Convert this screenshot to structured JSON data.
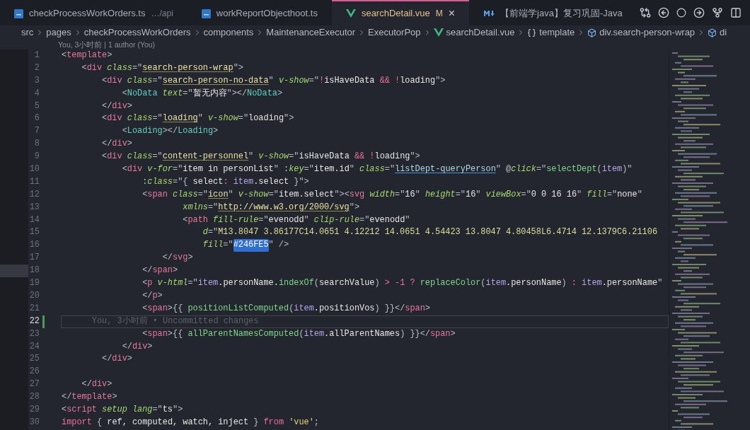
{
  "tabs": [
    {
      "label": "checkProcessWorkOrders.ts",
      "description": "…/api",
      "modified": false,
      "selected": false
    },
    {
      "label": "workReportObjecthoot.ts",
      "modified": false,
      "selected": false
    },
    {
      "label": "searchDetail.vue",
      "status": "M",
      "modified": true,
      "selected": true,
      "close": "×"
    },
    {
      "label": "【前端学java】复习巩固-Java",
      "modified": false,
      "selected": false
    }
  ],
  "breadcrumbs": [
    "src",
    "pages",
    "checkProcessWorkOrders",
    "components",
    "MaintenanceExecutor",
    "ExecutorPop",
    "searchDetail.vue",
    "template",
    "div.search-person-wrap",
    "di"
  ],
  "codelens": "You, 3小时前 | 1 author (You)",
  "lines": [
    {
      "number": "1",
      "current": false,
      "changed": false,
      "tokens": [
        {
          "kind": "p",
          "text": "<"
        },
        {
          "kind": "tag",
          "text": "template"
        },
        {
          "kind": "p",
          "text": ">"
        }
      ]
    },
    {
      "number": "2",
      "current": false,
      "changed": false,
      "tokens": [
        {
          "kind": "p",
          "text": "    <"
        },
        {
          "kind": "tag",
          "text": "div "
        },
        {
          "kind": "attr",
          "text": "class"
        },
        {
          "kind": "p",
          "text": "=\""
        },
        {
          "kind": "cls",
          "text": "search-person-wrap"
        },
        {
          "kind": "p",
          "text": "\">"
        }
      ]
    },
    {
      "number": "3",
      "current": false,
      "changed": false,
      "tokens": [
        {
          "kind": "p",
          "text": "        <"
        },
        {
          "kind": "tag",
          "text": "div "
        },
        {
          "kind": "attr",
          "text": "class"
        },
        {
          "kind": "p",
          "text": "=\""
        },
        {
          "kind": "cls",
          "text": "search-person-no-data"
        },
        {
          "kind": "p",
          "text": "\" "
        },
        {
          "kind": "attr",
          "text": "v-show"
        },
        {
          "kind": "p",
          "text": "=\""
        },
        {
          "kind": "op",
          "text": "!"
        },
        {
          "kind": "txt",
          "text": "isHaveData "
        },
        {
          "kind": "op",
          "text": "&& !"
        },
        {
          "kind": "txt",
          "text": "loading"
        },
        {
          "kind": "p",
          "text": "\">"
        }
      ]
    },
    {
      "number": "4",
      "current": false,
      "changed": false,
      "tokens": [
        {
          "kind": "p",
          "text": "            <"
        },
        {
          "kind": "comp",
          "text": "NoData "
        },
        {
          "kind": "attr",
          "text": "text"
        },
        {
          "kind": "p",
          "text": "=\""
        },
        {
          "kind": "txt",
          "text": "暂无内容"
        },
        {
          "kind": "p",
          "text": "\"></"
        },
        {
          "kind": "comp",
          "text": "NoData"
        },
        {
          "kind": "p",
          "text": ">"
        }
      ]
    },
    {
      "number": "5",
      "current": false,
      "changed": false,
      "tokens": [
        {
          "kind": "p",
          "text": "        </"
        },
        {
          "kind": "tag",
          "text": "div"
        },
        {
          "kind": "p",
          "text": ">"
        }
      ]
    },
    {
      "number": "6",
      "current": false,
      "changed": false,
      "tokens": [
        {
          "kind": "p",
          "text": "        <"
        },
        {
          "kind": "tag",
          "text": "div "
        },
        {
          "kind": "attr",
          "text": "class"
        },
        {
          "kind": "p",
          "text": "=\""
        },
        {
          "kind": "cls",
          "text": "loading"
        },
        {
          "kind": "p",
          "text": "\" "
        },
        {
          "kind": "attr",
          "text": "v-show"
        },
        {
          "kind": "p",
          "text": "=\""
        },
        {
          "kind": "txt",
          "text": "loading"
        },
        {
          "kind": "p",
          "text": "\">"
        }
      ]
    },
    {
      "number": "7",
      "current": false,
      "changed": false,
      "tokens": [
        {
          "kind": "p",
          "text": "            <"
        },
        {
          "kind": "comp",
          "text": "Loading"
        },
        {
          "kind": "p",
          "text": "></"
        },
        {
          "kind": "comp",
          "text": "Loading"
        },
        {
          "kind": "p",
          "text": ">"
        }
      ]
    },
    {
      "number": "8",
      "current": false,
      "changed": false,
      "tokens": [
        {
          "kind": "p",
          "text": "        </"
        },
        {
          "kind": "tag",
          "text": "div"
        },
        {
          "kind": "p",
          "text": ">"
        }
      ]
    },
    {
      "number": "9",
      "current": false,
      "changed": false,
      "tokens": [
        {
          "kind": "p",
          "text": "        <"
        },
        {
          "kind": "tag",
          "text": "div "
        },
        {
          "kind": "attr",
          "text": "class"
        },
        {
          "kind": "p",
          "text": "=\""
        },
        {
          "kind": "cls",
          "text": "content-personnel"
        },
        {
          "kind": "p",
          "text": "\" "
        },
        {
          "kind": "attr",
          "text": "v-show"
        },
        {
          "kind": "p",
          "text": "=\""
        },
        {
          "kind": "txt",
          "text": "isHaveData "
        },
        {
          "kind": "op",
          "text": "&& !"
        },
        {
          "kind": "txt",
          "text": "loading"
        },
        {
          "kind": "p",
          "text": "\">"
        }
      ]
    },
    {
      "number": "10",
      "current": false,
      "changed": false,
      "tokens": [
        {
          "kind": "p",
          "text": "            <"
        },
        {
          "kind": "tag",
          "text": "div "
        },
        {
          "kind": "attr",
          "text": "v-for"
        },
        {
          "kind": "p",
          "text": "=\""
        },
        {
          "kind": "txt",
          "text": "item in personList"
        },
        {
          "kind": "p",
          "text": "\" :"
        },
        {
          "kind": "attr",
          "text": "key"
        },
        {
          "kind": "p",
          "text": "=\""
        },
        {
          "kind": "txt",
          "text": "item.id"
        },
        {
          "kind": "p",
          "text": "\" "
        },
        {
          "kind": "attr",
          "text": "class"
        },
        {
          "kind": "p",
          "text": "=\""
        },
        {
          "kind": "link",
          "text": "listDept-queryPerson"
        },
        {
          "kind": "p",
          "text": "\" @"
        },
        {
          "kind": "attr",
          "text": "click"
        },
        {
          "kind": "p",
          "text": "=\""
        },
        {
          "kind": "fn",
          "text": "selectDept"
        },
        {
          "kind": "p",
          "text": "("
        },
        {
          "kind": "var",
          "text": "item"
        },
        {
          "kind": "p",
          "text": ")\""
        }
      ]
    },
    {
      "number": "11",
      "current": false,
      "changed": false,
      "tokens": [
        {
          "kind": "p",
          "text": "                :"
        },
        {
          "kind": "attr",
          "text": "class"
        },
        {
          "kind": "p",
          "text": "=\"{ "
        },
        {
          "kind": "txt",
          "text": "select"
        },
        {
          "kind": "op",
          "text": ": "
        },
        {
          "kind": "var",
          "text": "item"
        },
        {
          "kind": "txt",
          "text": ".select"
        },
        {
          "kind": "p",
          "text": " }\">"
        }
      ]
    },
    {
      "number": "12",
      "current": false,
      "changed": false,
      "tokens": [
        {
          "kind": "p",
          "text": "                <"
        },
        {
          "kind": "tag",
          "text": "span "
        },
        {
          "kind": "attr",
          "text": "class"
        },
        {
          "kind": "p",
          "text": "=\""
        },
        {
          "kind": "cls",
          "text": "icon"
        },
        {
          "kind": "p",
          "text": "\" "
        },
        {
          "kind": "attr",
          "text": "v-show"
        },
        {
          "kind": "p",
          "text": "=\""
        },
        {
          "kind": "txt",
          "text": "item.select"
        },
        {
          "kind": "p",
          "text": "\"><"
        },
        {
          "kind": "tag",
          "text": "svg "
        },
        {
          "kind": "attr",
          "text": "width"
        },
        {
          "kind": "p",
          "text": "=\""
        },
        {
          "kind": "txt",
          "text": "16"
        },
        {
          "kind": "p",
          "text": "\" "
        },
        {
          "kind": "attr",
          "text": "height"
        },
        {
          "kind": "p",
          "text": "=\""
        },
        {
          "kind": "txt",
          "text": "16"
        },
        {
          "kind": "p",
          "text": "\" "
        },
        {
          "kind": "attr",
          "text": "viewBox"
        },
        {
          "kind": "p",
          "text": "=\""
        },
        {
          "kind": "txt",
          "text": "0 0 16 16"
        },
        {
          "kind": "p",
          "text": "\" "
        },
        {
          "kind": "attr",
          "text": "fill"
        },
        {
          "kind": "p",
          "text": "=\""
        },
        {
          "kind": "txt",
          "text": "none"
        },
        {
          "kind": "p",
          "text": "\""
        }
      ]
    },
    {
      "number": "13",
      "current": false,
      "changed": false,
      "tokens": [
        {
          "kind": "attr",
          "text": "                        xmlns"
        },
        {
          "kind": "p",
          "text": "=\""
        },
        {
          "kind": "cls",
          "text": "http://www.w3.org/2000/svg"
        },
        {
          "kind": "p",
          "text": "\">"
        }
      ]
    },
    {
      "number": "14",
      "current": false,
      "changed": false,
      "tokens": [
        {
          "kind": "p",
          "text": "                        <"
        },
        {
          "kind": "tag",
          "text": "path "
        },
        {
          "kind": "attr",
          "text": "fill-rule"
        },
        {
          "kind": "p",
          "text": "=\""
        },
        {
          "kind": "txt",
          "text": "evenodd"
        },
        {
          "kind": "p",
          "text": "\" "
        },
        {
          "kind": "attr",
          "text": "clip-rule"
        },
        {
          "kind": "p",
          "text": "=\""
        },
        {
          "kind": "txt",
          "text": "evenodd"
        },
        {
          "kind": "p",
          "text": "\""
        }
      ]
    },
    {
      "number": "15",
      "current": false,
      "changed": false,
      "tokens": [
        {
          "kind": "attr",
          "text": "                            d"
        },
        {
          "kind": "p",
          "text": "=\""
        },
        {
          "kind": "num",
          "text": "M13.8047 3.86177C14.0651 4.12212 14.0651 4.54423 13.8047 4.80458L6.4714 12.1379C6.21106"
        }
      ]
    },
    {
      "number": "16",
      "current": false,
      "changed": false,
      "tokens": [
        {
          "kind": "attr",
          "text": "                            fill"
        },
        {
          "kind": "p",
          "text": "=\""
        },
        {
          "kind": "sel",
          "text": "#246FE5"
        },
        {
          "kind": "p",
          "text": "\" />"
        }
      ]
    },
    {
      "number": "17",
      "current": false,
      "changed": false,
      "tokens": [
        {
          "kind": "p",
          "text": "                    </"
        },
        {
          "kind": "tag",
          "text": "svg"
        },
        {
          "kind": "p",
          "text": ">"
        }
      ]
    },
    {
      "number": "18",
      "current": false,
      "changed": false,
      "tokens": [
        {
          "kind": "p",
          "text": "                </"
        },
        {
          "kind": "tag",
          "text": "span"
        },
        {
          "kind": "p",
          "text": ">"
        }
      ]
    },
    {
      "number": "19",
      "current": false,
      "changed": false,
      "tokens": [
        {
          "kind": "p",
          "text": "                <"
        },
        {
          "kind": "tag",
          "text": "p "
        },
        {
          "kind": "attr",
          "text": "v-html"
        },
        {
          "kind": "p",
          "text": "=\""
        },
        {
          "kind": "var",
          "text": "item"
        },
        {
          "kind": "txt",
          "text": ".personName."
        },
        {
          "kind": "fn",
          "text": "indexOf"
        },
        {
          "kind": "p",
          "text": "("
        },
        {
          "kind": "txt",
          "text": "searchValue"
        },
        {
          "kind": "p",
          "text": ")"
        },
        {
          "kind": "op",
          "text": " > -1 ? "
        },
        {
          "kind": "fn",
          "text": "replaceColor"
        },
        {
          "kind": "p",
          "text": "("
        },
        {
          "kind": "var",
          "text": "item"
        },
        {
          "kind": "txt",
          "text": ".personName"
        },
        {
          "kind": "p",
          "text": ")"
        },
        {
          "kind": "op",
          "text": " : "
        },
        {
          "kind": "var",
          "text": "item"
        },
        {
          "kind": "txt",
          "text": ".personName"
        },
        {
          "kind": "p",
          "text": "\""
        }
      ]
    },
    {
      "number": "20",
      "current": false,
      "changed": false,
      "tokens": [
        {
          "kind": "p",
          "text": "                </"
        },
        {
          "kind": "tag",
          "text": "p"
        },
        {
          "kind": "p",
          "text": ">"
        }
      ]
    },
    {
      "number": "21",
      "current": false,
      "changed": false,
      "tokens": [
        {
          "kind": "p",
          "text": "                <"
        },
        {
          "kind": "tag",
          "text": "span"
        },
        {
          "kind": "p",
          "text": ">{{ "
        },
        {
          "kind": "fn",
          "text": "positionListComputed"
        },
        {
          "kind": "p",
          "text": "("
        },
        {
          "kind": "var",
          "text": "item"
        },
        {
          "kind": "txt",
          "text": ".positionVos"
        },
        {
          "kind": "p",
          "text": ") }}</"
        },
        {
          "kind": "tag",
          "text": "span"
        },
        {
          "kind": "p",
          "text": ">"
        }
      ]
    },
    {
      "number": "22",
      "current": true,
      "changed": true,
      "tokens": [
        {
          "kind": "ghost",
          "text": "      You, 3小时前 • Uncommitted changes"
        }
      ]
    },
    {
      "number": "23",
      "current": false,
      "changed": false,
      "tokens": [
        {
          "kind": "p",
          "text": "                <"
        },
        {
          "kind": "tag",
          "text": "span"
        },
        {
          "kind": "p",
          "text": ">{{ "
        },
        {
          "kind": "fn",
          "text": "allParentNamesComputed"
        },
        {
          "kind": "p",
          "text": "("
        },
        {
          "kind": "var",
          "text": "item"
        },
        {
          "kind": "txt",
          "text": ".allParentNames"
        },
        {
          "kind": "p",
          "text": ") }}</"
        },
        {
          "kind": "tag",
          "text": "span"
        },
        {
          "kind": "p",
          "text": ">"
        }
      ]
    },
    {
      "number": "24",
      "current": false,
      "changed": false,
      "tokens": [
        {
          "kind": "p",
          "text": "            </"
        },
        {
          "kind": "tag",
          "text": "div"
        },
        {
          "kind": "p",
          "text": ">"
        }
      ]
    },
    {
      "number": "25",
      "current": false,
      "changed": false,
      "tokens": [
        {
          "kind": "p",
          "text": "        </"
        },
        {
          "kind": "tag",
          "text": "div"
        },
        {
          "kind": "p",
          "text": ">"
        }
      ]
    },
    {
      "number": "26",
      "current": false,
      "changed": false
    },
    {
      "number": "27",
      "current": false,
      "changed": false,
      "tokens": [
        {
          "kind": "p",
          "text": "    </"
        },
        {
          "kind": "tag",
          "text": "div"
        },
        {
          "kind": "p",
          "text": ">"
        }
      ]
    },
    {
      "number": "28",
      "current": false,
      "changed": false,
      "tokens": [
        {
          "kind": "p",
          "text": "</"
        },
        {
          "kind": "tag",
          "text": "template"
        },
        {
          "kind": "p",
          "text": ">"
        }
      ]
    },
    {
      "number": "29",
      "current": false,
      "changed": false,
      "tokens": [
        {
          "kind": "p",
          "text": "<"
        },
        {
          "kind": "tag",
          "text": "script "
        },
        {
          "kind": "attr",
          "text": "setup lang"
        },
        {
          "kind": "p",
          "text": "=\""
        },
        {
          "kind": "txt",
          "text": "ts"
        },
        {
          "kind": "p",
          "text": "\">"
        }
      ]
    },
    {
      "number": "30",
      "current": false,
      "changed": false,
      "tokens": [
        {
          "kind": "kw",
          "text": "import"
        },
        {
          "kind": "p",
          "text": " { "
        },
        {
          "kind": "txt",
          "text": "ref, computed, watch, inject"
        },
        {
          "kind": "p",
          "text": " } "
        },
        {
          "kind": "kw",
          "text": "from "
        },
        {
          "kind": "strq",
          "text": "'vue'"
        },
        {
          "kind": "p",
          "text": ";"
        }
      ]
    }
  ]
}
